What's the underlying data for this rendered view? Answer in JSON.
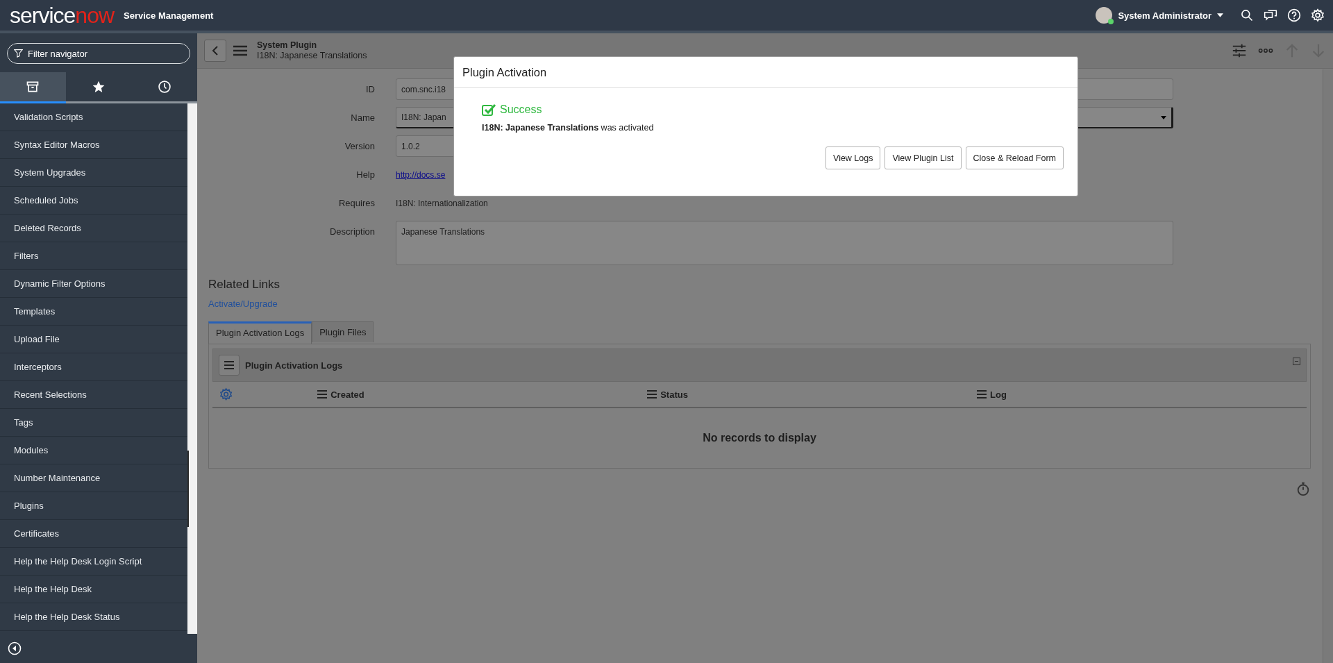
{
  "header": {
    "logo": {
      "text_main": "service",
      "text_accent": "now"
    },
    "product": "Service Management",
    "user": {
      "name": "System Administrator",
      "online": true
    }
  },
  "navigator": {
    "filter": {
      "placeholder": "Filter navigator"
    },
    "tabs": [
      {
        "kind": "all",
        "selected": true
      },
      {
        "kind": "favorites",
        "selected": false
      },
      {
        "kind": "history",
        "selected": false
      }
    ],
    "items": [
      {
        "label": "Validation Scripts"
      },
      {
        "label": "Syntax Editor Macros"
      },
      {
        "label": "System Upgrades"
      },
      {
        "label": "Scheduled Jobs"
      },
      {
        "label": "Deleted Records"
      },
      {
        "label": "Filters"
      },
      {
        "label": "Dynamic Filter Options"
      },
      {
        "label": "Templates"
      },
      {
        "label": "Upload File"
      },
      {
        "label": "Interceptors"
      },
      {
        "label": "Recent Selections"
      },
      {
        "label": "Tags"
      },
      {
        "label": "Modules"
      },
      {
        "label": "Number Maintenance"
      },
      {
        "label": "Plugins"
      },
      {
        "label": "Certificates"
      },
      {
        "label": "Help the Help Desk Login Script"
      },
      {
        "label": "Help the Help Desk"
      },
      {
        "label": "Help the Help Desk Status"
      }
    ]
  },
  "form": {
    "table": "System Plugin",
    "record": "I18N: Japanese Translations",
    "fields": [
      {
        "kind": "text",
        "label": "ID",
        "value": "com.snc.i18"
      },
      {
        "kind": "select",
        "label": "Name",
        "value": "I18N: Japan"
      },
      {
        "kind": "short",
        "label": "Version",
        "value": "1.0.2"
      },
      {
        "kind": "link",
        "label": "Help",
        "value": "http://docs.se"
      },
      {
        "kind": "plain",
        "label": "Requires",
        "value": "I18N: Internationalization"
      },
      {
        "kind": "textarea",
        "label": "Description",
        "value": "Japanese Translations"
      }
    ],
    "related_links": {
      "title": "Related Links",
      "links": [
        "Activate/Upgrade"
      ]
    },
    "related_tabs": [
      {
        "label": "Plugin Activation Logs",
        "selected": true
      },
      {
        "label": "Plugin Files",
        "selected": false
      }
    ],
    "list": {
      "title": "Plugin Activation Logs",
      "columns": [
        "Created",
        "Status",
        "Log"
      ],
      "empty": "No records to display"
    }
  },
  "dialog": {
    "title": "Plugin Activation",
    "status": "Success",
    "message": "**I18N: Japanese Translations** was activated",
    "buttons": [
      "View Logs",
      "View Plugin List",
      "Close & Reload Form"
    ]
  }
}
